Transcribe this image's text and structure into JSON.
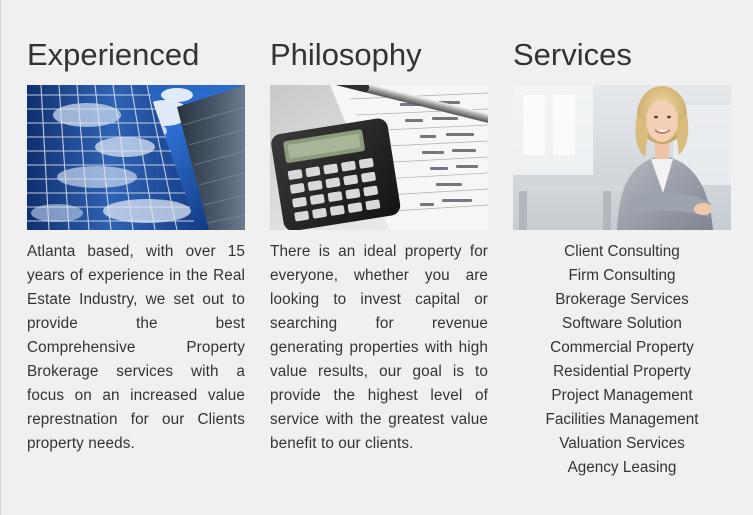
{
  "columns": {
    "experienced": {
      "title": "Experienced",
      "text": "Atlanta based, with over 15 years of experience in the Real Estate Industry, we set out to provide the best Comprehensive Property Brokerage services with a focus on an increased value represtnation for our Clients property needs."
    },
    "philosophy": {
      "title": "Philosophy",
      "text": "There is an ideal property for everyone, whether you are looking to invest capital or searching for revenue generating properties with high value results, our goal is to provide the highest level of service with the greatest value benefit to our clients."
    },
    "services": {
      "title": "Services",
      "items": [
        "Client Consulting",
        "Firm Consulting",
        "Brokerage Services",
        "Software Solution",
        "Commercial Property",
        "Residential Property",
        "Project Management",
        "Facilities Management",
        "Valuation Services",
        "Agency Leasing"
      ]
    }
  },
  "images": {
    "experienced": "skyscraper-glass-facade-photo",
    "philosophy": "calculator-pen-financial-papers-photo",
    "services": "smiling-businesswoman-office-photo"
  },
  "colors": {
    "background": "#f0f0f0",
    "text": "#333333",
    "heading": "#333333"
  }
}
